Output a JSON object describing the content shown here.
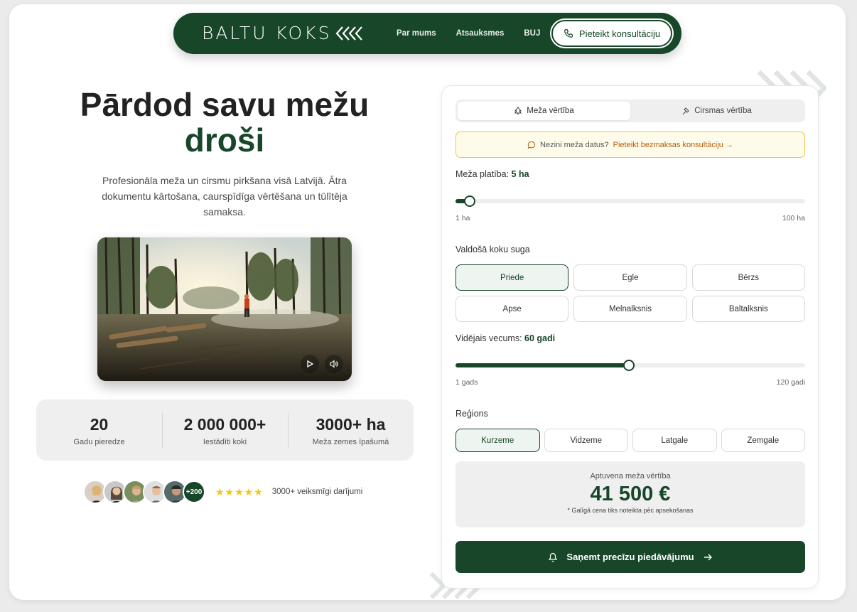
{
  "brand": {
    "logo_text": "BALTU KOKS"
  },
  "nav": {
    "links": [
      "Par mums",
      "Atsauksmes",
      "BUJ"
    ],
    "cta_label": "Pieteikt konsultāciju"
  },
  "hero": {
    "title_line1": "Pārdod savu mežu",
    "title_accent": "droši",
    "description": "Profesionāla meža un cirsmu pirkšana visā Latvijā. Ātra dokumentu kārtošana, caurspīdīga vērtēšana un tūlītēja samaksa."
  },
  "video": {
    "play_icon": "play-icon",
    "sound_icon": "volume-icon"
  },
  "stats": [
    {
      "value": "20",
      "label": "Gadu pieredze"
    },
    {
      "value": "2 000 000+",
      "label": "Iestādīti koki"
    },
    {
      "value": "3000+ ha",
      "label": "Meža zemes īpašumā"
    }
  ],
  "social_proof": {
    "more_count": "+200",
    "stars": "★★★★★",
    "text": "3000+ veiksmīgi darījumi"
  },
  "calculator": {
    "tabs": [
      {
        "label": "Meža vērtība",
        "icon": "tree-icon",
        "active": true
      },
      {
        "label": "Cirsmas vērtība",
        "icon": "axe-icon",
        "active": false
      }
    ],
    "notice": {
      "text": "Nezini meža datus?",
      "link": "Pieteikt bezmaksas konsultāciju →"
    },
    "area": {
      "label": "Meža platība:",
      "value": "5 ha",
      "min_label": "1 ha",
      "max_label": "100 ha",
      "min": 1,
      "max": 100,
      "current": 5
    },
    "species": {
      "label": "Valdošā koku suga",
      "options": [
        "Priede",
        "Egle",
        "Bērzs",
        "Apse",
        "Melnalksnis",
        "Baltalksnis"
      ],
      "selected": "Priede"
    },
    "age": {
      "label": "Vidējais vecums:",
      "value": "60 gadi",
      "min_label": "1 gads",
      "max_label": "120 gadi",
      "min": 1,
      "max": 120,
      "current": 60
    },
    "region": {
      "label": "Reģions",
      "options": [
        "Kurzeme",
        "Vidzeme",
        "Latgale",
        "Zemgale"
      ],
      "selected": "Kurzeme"
    },
    "result": {
      "label": "Aptuvena meža vērtība",
      "value": "41 500 €",
      "note": "* Galīgā cena tiks noteikta pēc apsekošanas"
    },
    "cta_label": "Saņemt precīzu piedāvājumu"
  },
  "colors": {
    "brand_green": "#174629",
    "notice_bg": "#fffbea",
    "notice_border": "#e9c84a",
    "link_orange": "#b45a08",
    "star": "#f5c518"
  }
}
